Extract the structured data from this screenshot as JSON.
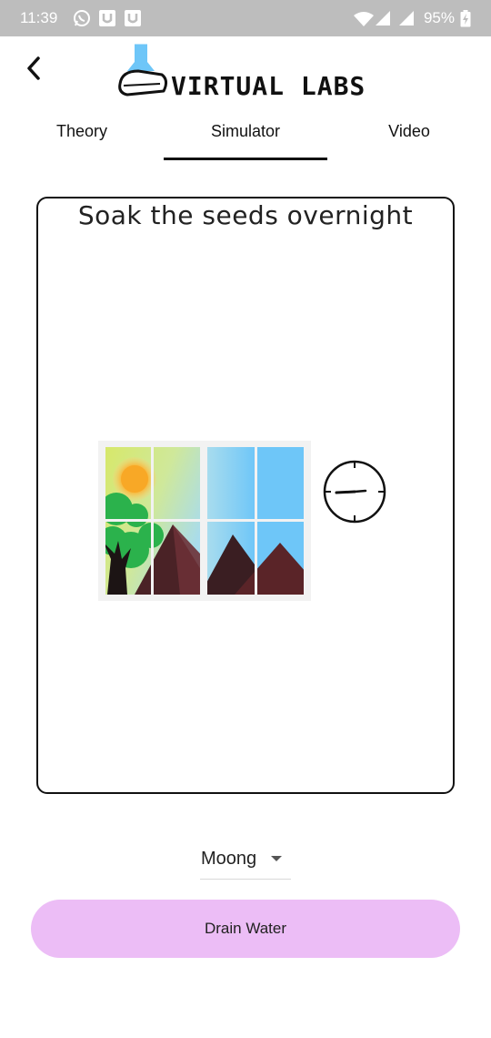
{
  "status_bar": {
    "time": "11:39",
    "battery": "95%",
    "icons": [
      "whatsapp-icon",
      "u-app-icon",
      "u-app-icon",
      "wifi-icon",
      "mobile-signal-icon",
      "signal-icon",
      "battery-charging-icon"
    ]
  },
  "header": {
    "logo_text": "VIRTUAL LABS",
    "logo_icon": "flask-icon"
  },
  "tabs": [
    {
      "label": "Theory",
      "active": false
    },
    {
      "label": "Simulator",
      "active": true
    },
    {
      "label": "Video",
      "active": false
    }
  ],
  "simulator": {
    "title": "Soak the seeds overnight",
    "scene": "window-scene",
    "timer_icon": "clock-icon"
  },
  "seed_select": {
    "value": "Moong"
  },
  "action_button": {
    "label": "Drain Water",
    "color": "#ecbdf6"
  },
  "colors": {
    "status_bar": "#bdbdbd",
    "text": "#111111",
    "sky_blue": "#6ec6f8",
    "sun": "#f8a826",
    "tree_green": "#2bb24c",
    "mountain": "#5a2428"
  }
}
